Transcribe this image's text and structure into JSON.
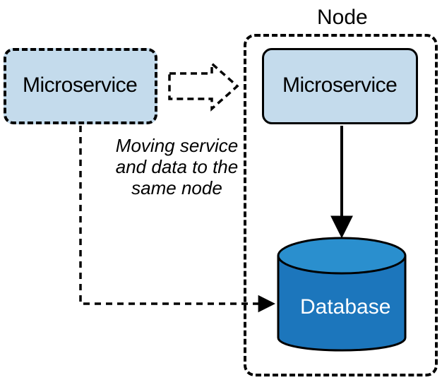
{
  "node": {
    "title": "Node"
  },
  "left_service": {
    "label": "Microservice"
  },
  "right_service": {
    "label": "Microservice"
  },
  "caption": {
    "text": "Moving service\nand data to the\nsame node"
  },
  "database": {
    "label": "Database"
  },
  "colors": {
    "microservice_fill": "#c4dbec",
    "database_fill": "#1c76bc",
    "database_top": "#2a8fce",
    "outline": "#000000"
  }
}
